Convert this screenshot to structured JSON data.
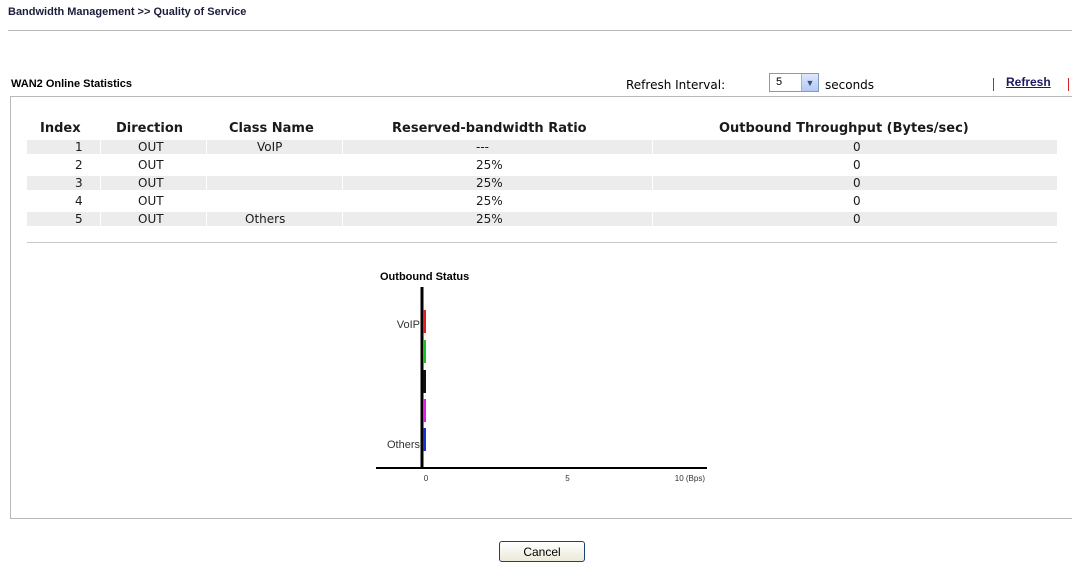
{
  "breadcrumb": "Bandwidth Management >> Quality of Service",
  "panel": {
    "title": "WAN2 Online Statistics",
    "refresh_interval_label": "Refresh Interval:",
    "refresh_interval_value": "5",
    "seconds_label": "seconds",
    "refresh_link": "Refresh"
  },
  "table": {
    "headers": [
      "Index",
      "Direction",
      "Class Name",
      "Reserved-bandwidth Ratio",
      "Outbound Throughput (Bytes/sec)"
    ],
    "rows": [
      {
        "index": "1",
        "direction": "OUT",
        "class_name": "VoIP",
        "ratio": "---",
        "throughput": "0"
      },
      {
        "index": "2",
        "direction": "OUT",
        "class_name": "",
        "ratio": "25%",
        "throughput": "0"
      },
      {
        "index": "3",
        "direction": "OUT",
        "class_name": "",
        "ratio": "25%",
        "throughput": "0"
      },
      {
        "index": "4",
        "direction": "OUT",
        "class_name": "",
        "ratio": "25%",
        "throughput": "0"
      },
      {
        "index": "5",
        "direction": "OUT",
        "class_name": "Others",
        "ratio": "25%",
        "throughput": "0"
      }
    ]
  },
  "chart_data": {
    "type": "bar",
    "title": "Outbound Status",
    "orientation": "horizontal",
    "categories": [
      "VoIP",
      "",
      "",
      "",
      "Others"
    ],
    "values": [
      0,
      0,
      0,
      0,
      0
    ],
    "colors": [
      "#e02020",
      "#20c020",
      "#111111",
      "#e020e0",
      "#1f2fd0"
    ],
    "x_ticks": [
      "0",
      "5",
      "10 (Bps)"
    ],
    "xlim": [
      0,
      10
    ]
  },
  "cancel_label": "Cancel"
}
